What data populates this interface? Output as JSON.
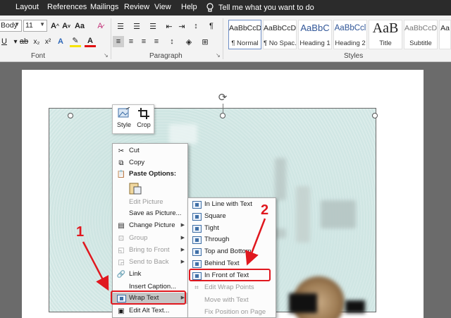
{
  "tabs": [
    "Layout",
    "References",
    "Mailings",
    "Review",
    "View",
    "Help"
  ],
  "tell_me": "Tell me what you want to do",
  "ribbon": {
    "font_name": "Body",
    "font_size": "11",
    "groups": {
      "font": "Font",
      "paragraph": "Paragraph",
      "styles": "Styles"
    },
    "styles": [
      {
        "sample": "AaBbCcDc",
        "name": "¶ Normal"
      },
      {
        "sample": "AaBbCcDc",
        "name": "¶ No Spac..."
      },
      {
        "sample": "AaBbC",
        "name": "Heading 1"
      },
      {
        "sample": "AaBbCcl",
        "name": "Heading 2"
      },
      {
        "sample": "AaB",
        "name": "Title"
      },
      {
        "sample": "AaBbCcD",
        "name": "Subtitle"
      },
      {
        "sample": "Aa",
        "name": ""
      }
    ]
  },
  "mini_toolbar": {
    "style": "Style",
    "crop": "Crop"
  },
  "context_menu": {
    "items": [
      {
        "label": "Cut",
        "icon": "scissors-icon"
      },
      {
        "label": "Copy",
        "icon": "copy-icon"
      },
      {
        "label": "Paste Options:",
        "icon": "paste-icon"
      },
      {
        "label": "Edit Picture"
      },
      {
        "label": "Save as Picture..."
      },
      {
        "label": "Change Picture",
        "icon": "change-picture-icon"
      },
      {
        "label": "Group",
        "icon": "group-icon"
      },
      {
        "label": "Bring to Front",
        "icon": "bring-front-icon"
      },
      {
        "label": "Send to Back",
        "icon": "send-back-icon"
      },
      {
        "label": "Link",
        "icon": "link-icon"
      },
      {
        "label": "Insert Caption..."
      },
      {
        "label": "Wrap Text",
        "icon": "wrap-text-icon"
      },
      {
        "label": "Edit Alt Text..."
      }
    ]
  },
  "wrap_menu": {
    "items": [
      {
        "label": "In Line with Text"
      },
      {
        "label": "Square"
      },
      {
        "label": "Tight"
      },
      {
        "label": "Through"
      },
      {
        "label": "Top and Bottom"
      },
      {
        "label": "Behind Text"
      },
      {
        "label": "In Front of Text"
      },
      {
        "label": "Edit Wrap Points"
      },
      {
        "label": "Move with Text"
      },
      {
        "label": "Fix Position on Page"
      }
    ]
  },
  "annotations": {
    "step1": "1",
    "step2": "2"
  },
  "colors": {
    "accent_red": "#e0181f",
    "tab_bar": "#2b2b2b",
    "ribbon": "#f3f3f3"
  }
}
